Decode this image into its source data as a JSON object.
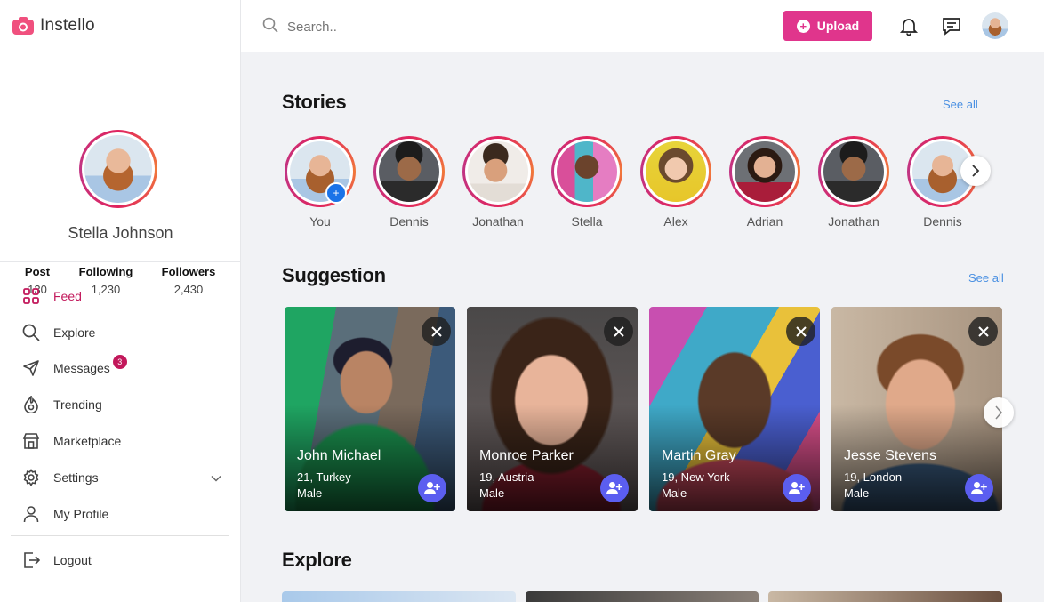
{
  "app": {
    "name": "Instello"
  },
  "search": {
    "placeholder": "Search.."
  },
  "topbar": {
    "upload_label": "Upload"
  },
  "profile": {
    "name": "Stella Johnson",
    "stats": [
      {
        "label": "Post",
        "value": "130"
      },
      {
        "label": "Following",
        "value": "1,230"
      },
      {
        "label": "Followers",
        "value": "2,430"
      }
    ]
  },
  "nav": {
    "items": [
      {
        "label": "Feed"
      },
      {
        "label": "Explore"
      },
      {
        "label": "Messages",
        "badge": "3"
      },
      {
        "label": "Trending"
      },
      {
        "label": "Marketplace"
      },
      {
        "label": "Settings"
      },
      {
        "label": "My Profile"
      }
    ],
    "logout": "Logout"
  },
  "stories": {
    "title": "Stories",
    "see_all": "See all",
    "items": [
      "You",
      "Dennis",
      "Jonathan",
      "Stella",
      "Alex",
      "Adrian",
      "Jonathan",
      "Dennis"
    ]
  },
  "suggestion": {
    "title": "Suggestion",
    "see_all": "See all",
    "cards": [
      {
        "name": "John Michael",
        "info": "21, Turkey",
        "gender": "Male"
      },
      {
        "name": "Monroe Parker",
        "info": "19, Austria",
        "gender": "Male"
      },
      {
        "name": "Martin Gray",
        "info": "19, New York",
        "gender": "Male"
      },
      {
        "name": "Jesse Stevens",
        "info": "19, London",
        "gender": "Male"
      }
    ]
  },
  "explore": {
    "title": "Explore"
  },
  "colors": {
    "accent": "#e0358c",
    "active": "#c2185b",
    "link": "#4a90e2",
    "add_friend": "#5b5ef0"
  }
}
